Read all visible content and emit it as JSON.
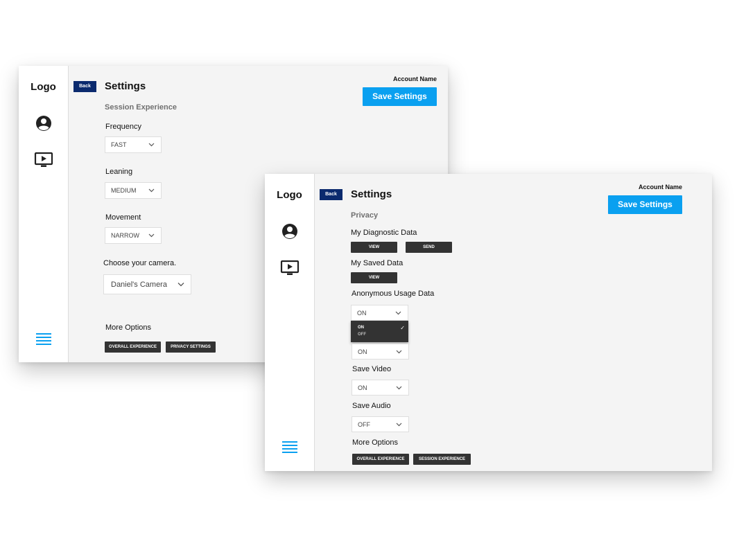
{
  "colors": {
    "accent": "#0aa0f0",
    "back": "#0b2a6e",
    "dark_button": "#333333",
    "panel": "#f4f4f4"
  },
  "window1": {
    "logo": "Logo",
    "nav_icons": [
      "account-circle-icon",
      "video-player-icon",
      "menu-icon"
    ],
    "back_label": "Back",
    "title": "Settings",
    "account_name": "Account Name",
    "save_label": "Save Settings",
    "section": "Session Experience",
    "fields": [
      {
        "label": "Frequency",
        "value": "FAST"
      },
      {
        "label": "Leaning",
        "value": "MEDIUM"
      },
      {
        "label": "Movement",
        "value": "NARROW"
      }
    ],
    "camera": {
      "label": "Choose your camera.",
      "value": "Daniel's Camera"
    },
    "more_options": {
      "label": "More Options",
      "buttons": [
        "OVERALL EXPERIENCE",
        "PRIVACY SETTINGS"
      ]
    }
  },
  "window2": {
    "logo": "Logo",
    "nav_icons": [
      "account-circle-icon",
      "video-player-icon",
      "menu-icon"
    ],
    "back_label": "Back",
    "title": "Settings",
    "account_name": "Account Name",
    "save_label": "Save Settings",
    "section": "Privacy",
    "diagnostic": {
      "label": "My Diagnostic Data",
      "view": "VIEW",
      "send": "SEND"
    },
    "saved_data": {
      "label": "My Saved Data",
      "view": "VIEW"
    },
    "anonymous": {
      "label": "Anonymous Usage Data",
      "value": "ON",
      "options": [
        "ON",
        "OFF"
      ],
      "selected": "ON"
    },
    "hidden_field": {
      "value": "ON"
    },
    "save_video": {
      "label": "Save Video",
      "value": "ON"
    },
    "save_audio": {
      "label": "Save Audio",
      "value": "OFF"
    },
    "more_options": {
      "label": "More Options",
      "buttons": [
        "OVERALL EXPERIENCE",
        "SESSION EXPERIENCE"
      ]
    }
  }
}
